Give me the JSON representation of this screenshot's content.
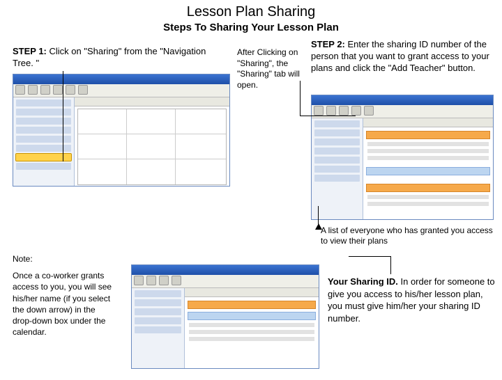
{
  "title": "Lesson Plan Sharing",
  "subtitle": "Steps To Sharing Your Lesson Plan",
  "step1": {
    "label": "STEP 1:",
    "text": " Click on \"Sharing\" from the \"Navigation Tree. \""
  },
  "after_click": "After Clicking on \"Sharing\", the \"Sharing\" tab  will open.",
  "step2": {
    "label": "STEP 2:",
    "text": " Enter the sharing ID number of the person that you want to grant access to  your plans and click the \"Add Teacher\" button."
  },
  "list_caption": "A list of everyone who has granted you access to view their plans",
  "note_heading": "Note:",
  "note_body": "Once a co-worker grants access to you, you will see his/her name (if you select the down arrow) in the drop-down box under the calendar.",
  "sharing_id": {
    "label": "Your Sharing ID.",
    "text": "  In order for someone to give you access to his/her lesson plan, you must give him/her your sharing ID number."
  }
}
